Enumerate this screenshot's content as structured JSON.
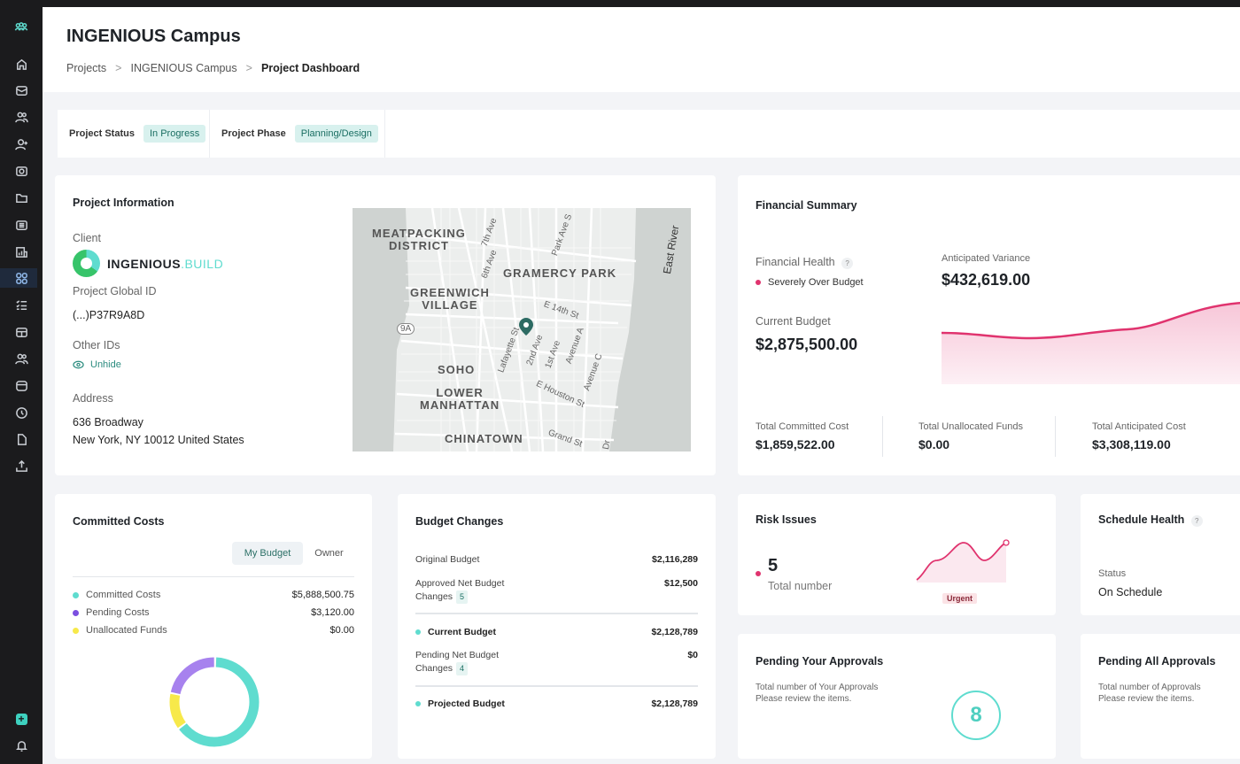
{
  "sidebar": {
    "icons": [
      "team-logo",
      "home",
      "inbox",
      "users",
      "user-add",
      "budget",
      "folder",
      "list",
      "reports",
      "dashboard",
      "checklist",
      "table",
      "contacts",
      "calendar",
      "clock",
      "document",
      "upload"
    ],
    "bottom": [
      "add",
      "bell"
    ]
  },
  "header": {
    "title": "INGENIOUS Campus",
    "breadcrumb": [
      "Projects",
      "INGENIOUS Campus",
      "Project Dashboard"
    ],
    "sep": ">"
  },
  "status": {
    "status_label": "Project Status",
    "status_value": "In Progress",
    "phase_label": "Project Phase",
    "phase_value": "Planning/Design"
  },
  "project_info": {
    "title": "Project Information",
    "client_label": "Client",
    "client_logo": "INGENIOUS",
    "client_logo_suffix": ".BUILD",
    "global_id_label": "Project Global ID",
    "global_id": "(...)P37R9A8D",
    "other_ids_label": "Other IDs",
    "unhide": "Unhide",
    "address_label": "Address",
    "address_line1": "636 Broadway",
    "address_line2": "New York, NY 10012 United States",
    "map": {
      "areas": [
        "MEATPACKING\nDISTRICT",
        "GRAMERCY PARK",
        "GREENWICH\nVILLAGE",
        "SOHO",
        "LOWER\nMANHATTAN",
        "CHINATOWN"
      ],
      "streets": [
        "7th Ave",
        "6th Ave",
        "Park Ave S",
        "E 14th St",
        "Lafayette St",
        "2nd Ave",
        "1st Ave",
        "Avenue A",
        "Avenue C",
        "E Houston St",
        "Grand St",
        "East River",
        "9A",
        "Dr"
      ]
    }
  },
  "financial": {
    "title": "Financial Summary",
    "health_label": "Financial Health",
    "help": "?",
    "health_value": "Severely Over Budget",
    "variance_label": "Anticipated Variance",
    "variance": "$432,619.00",
    "budget_label": "Current Budget",
    "budget": "$2,875,500.00",
    "totals": [
      {
        "label": "Total Committed Cost",
        "value": "$1,859,522.00"
      },
      {
        "label": "Total Unallocated Funds",
        "value": "$0.00"
      },
      {
        "label": "Total Anticipated Cost",
        "value": "$3,308,119.00"
      }
    ],
    "accent": "#e0336e"
  },
  "committed": {
    "title": "Committed Costs",
    "tabs": [
      "My Budget",
      "Owner"
    ],
    "items": [
      {
        "label": "Committed Costs",
        "value": "$5,888,500.75",
        "color": "#5fdccf"
      },
      {
        "label": "Pending Costs",
        "value": "$3,120.00",
        "color": "#7b4fe0"
      },
      {
        "label": "Unallocated Funds",
        "value": "$0.00",
        "color": "#f7e94a"
      }
    ]
  },
  "budget_changes": {
    "title": "Budget Changes",
    "original_label": "Original Budget",
    "original": "$2,116,289",
    "approved_label": "Approved Net Budget",
    "approved_label2": "Changes",
    "approved_count": "5",
    "approved": "$12,500",
    "current_label": "Current Budget",
    "current": "$2,128,789",
    "pending_label": "Pending Net Budget",
    "pending_label2": "Changes",
    "pending_count": "4",
    "pending": "$0",
    "projected_label": "Projected Budget",
    "projected": "$2,128,789"
  },
  "risk": {
    "title": "Risk Issues",
    "count": "5",
    "count_label": "Total number",
    "tag": "Urgent"
  },
  "schedule": {
    "title": "Schedule Health",
    "help": "?",
    "status_label": "Status",
    "status": "On Schedule"
  },
  "pending_your": {
    "title": "Pending Your Approvals",
    "line1": "Total number of Your Approvals",
    "line2": "Please review the items.",
    "count": "8"
  },
  "pending_all": {
    "title": "Pending All Approvals",
    "line1": "Total number of Approvals",
    "line2": "Please review the items."
  }
}
